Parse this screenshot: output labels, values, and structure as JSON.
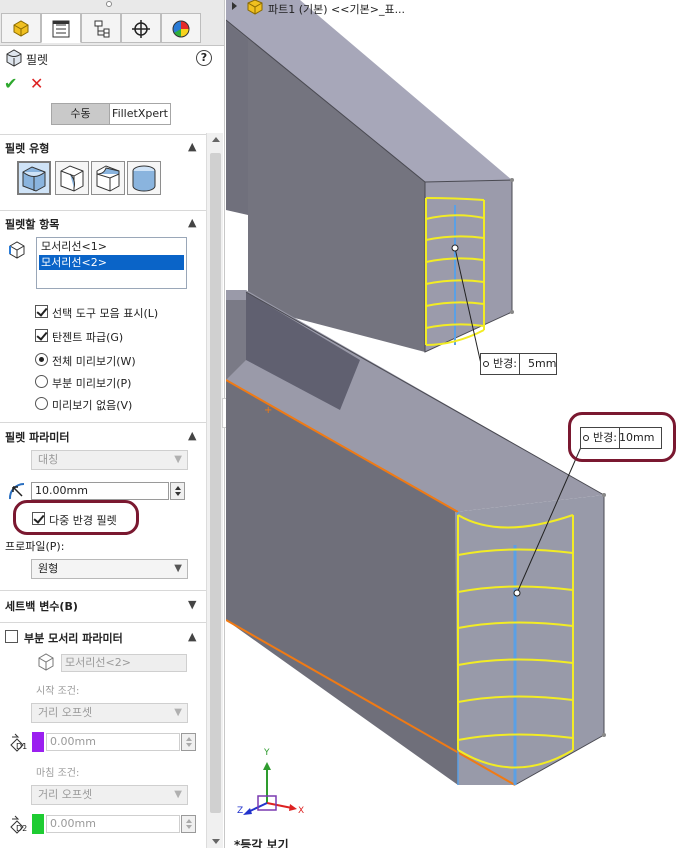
{
  "panel": {
    "title": "필렛",
    "help_symbol": "?",
    "ok_symbol": "✔",
    "cancel_symbol": "✕",
    "mode_tabs": [
      "수동",
      "FilletXpert"
    ],
    "fillet_type": {
      "title": "필렛 유형",
      "selected_index": 0,
      "buttons": [
        "constant-size-fillet-icon",
        "variable-size-fillet-icon",
        "face-fillet-icon",
        "full-round-fillet-icon"
      ]
    },
    "items": {
      "title": "필렛할 항목",
      "list": [
        "모서리선<1>",
        "모서리선<2>"
      ],
      "selected_index": 1,
      "options": [
        {
          "type": "check",
          "checked": true,
          "label": "선택 도구 모음 표시(L)"
        },
        {
          "type": "check",
          "checked": true,
          "label": "탄젠트 파급(G)"
        },
        {
          "type": "radio",
          "checked": true,
          "label": "전체 미리보기(W)"
        },
        {
          "type": "radio",
          "checked": false,
          "label": "부분 미리보기(P)"
        },
        {
          "type": "radio",
          "checked": false,
          "label": "미리보기 없음(V)"
        }
      ]
    },
    "params": {
      "title": "필렛 파라미터",
      "symmetry": "대칭",
      "radius": "10.00mm",
      "multi_radius_checked": true,
      "multi_radius_label": "다중 반경 필렛",
      "profile_label": "프로파일(P):",
      "profile_value": "원형"
    },
    "setback": {
      "title": "세트백 변수(B)"
    },
    "partial": {
      "title": "부분 모서리 파라미터",
      "checked": false,
      "edge_field": "모서리선<2>",
      "start_label": "시작 조건:",
      "start_combo": "거리 오프셋",
      "d1_value": "0.00mm",
      "d1_color": "#9b1ff0",
      "end_label": "마침 조건:",
      "end_combo": "거리 오프셋",
      "d2_value": "0.00mm",
      "d2_color": "#1ecc32",
      "d1_tag": "D1",
      "d2_tag": "D2"
    }
  },
  "viewport": {
    "tree_text": "파트1 (기본) <<기본>_표...",
    "callout_top": {
      "label": "반경:",
      "value": "5mm"
    },
    "callout_bottom": {
      "label": "반경:",
      "value": "10mm"
    },
    "triad_labels": {
      "y": "Y",
      "z": "Z",
      "x": "X"
    },
    "bottom_text": "*등각 보기"
  },
  "colors": {
    "accent_blue": "#0a64c8",
    "annotation_red": "#7a1830",
    "body_gray": "#7b7b8b",
    "fillet_yellow": "#f2ec24",
    "edge_orange": "#f07a14",
    "edge_blue": "#5aa0e6"
  }
}
